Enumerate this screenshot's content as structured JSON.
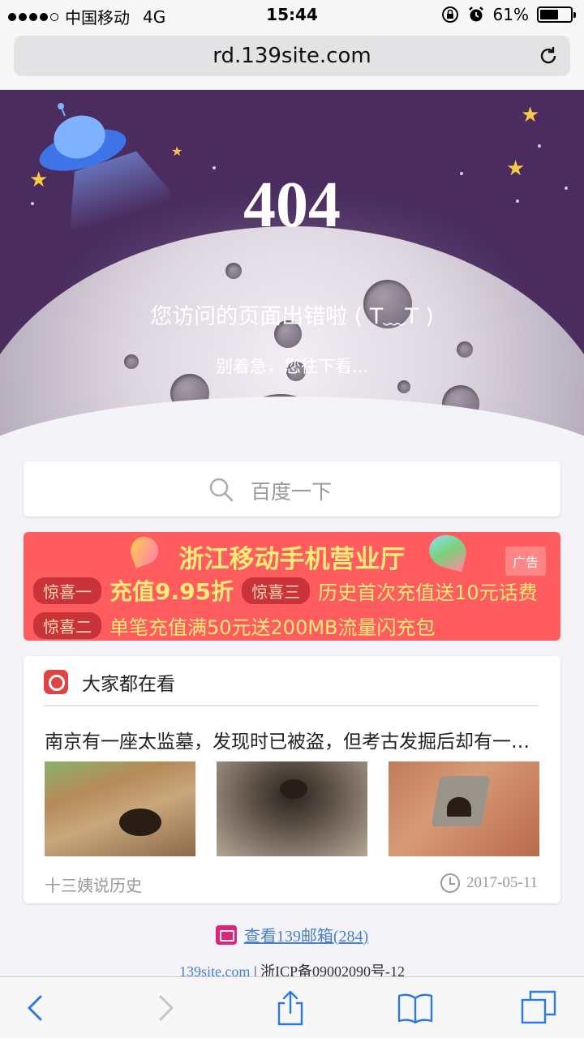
{
  "status_bar": {
    "carrier": "中国移动",
    "network": "4G",
    "time": "15:44",
    "battery_percent": "61%",
    "battery_level": 0.61
  },
  "browser": {
    "url": "rd.139site.com"
  },
  "hero": {
    "code": "404",
    "message": "您访问的页面出错啦 ( T﹏T )",
    "sub_message": "别着急，您往下看..."
  },
  "search": {
    "placeholder": "百度一下"
  },
  "ad": {
    "title": "浙江移动手机营业厅",
    "badge": "广告",
    "line1": {
      "tag": "惊喜一",
      "text": "充值9.95折",
      "tag2": "惊喜三",
      "text2": "历史首次充值送10元话费"
    },
    "line2": {
      "tag": "惊喜二",
      "text": "单笔充值满50元送200MB流量闪充包"
    }
  },
  "news": {
    "heading": "大家都在看",
    "title": "南京有一座太监墓，发现时已被盗，但考古发掘后却有一…",
    "source": "十三姨说历史",
    "date": "2017-05-11"
  },
  "footer": {
    "mail_link": "查看139邮箱(284)",
    "site": "139site.com",
    "icp": " | 浙ICP备09002090号-12"
  },
  "colors": {
    "hero_bg": "#4a2c5f",
    "ad_bg": "#ff5c5f",
    "link": "#4a80c8",
    "ios_blue": "#2b7ae0"
  }
}
